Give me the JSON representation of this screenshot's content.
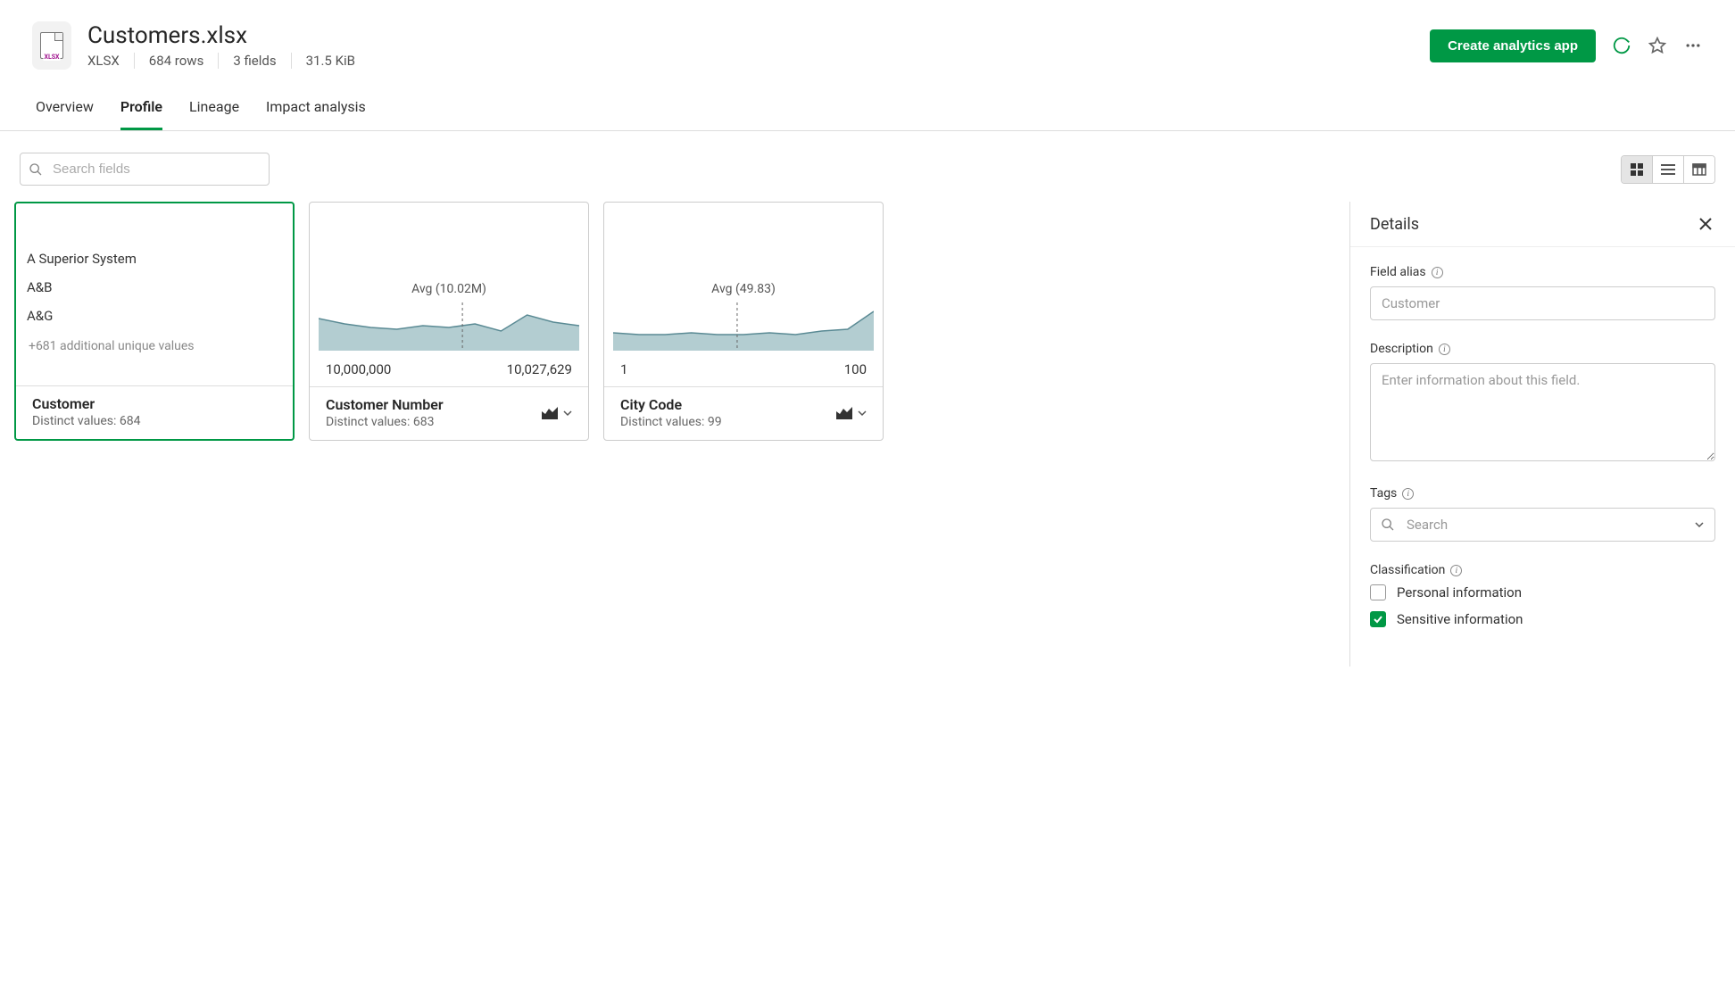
{
  "header": {
    "title": "Customers.xlsx",
    "fileType": "XLSX",
    "rows": "684 rows",
    "fields": "3 fields",
    "size": "31.5 KiB",
    "createBtn": "Create analytics app",
    "fileBadge": "XLSX"
  },
  "tabs": [
    {
      "label": "Overview",
      "active": false
    },
    {
      "label": "Profile",
      "active": true
    },
    {
      "label": "Lineage",
      "active": false
    },
    {
      "label": "Impact analysis",
      "active": false
    }
  ],
  "search": {
    "placeholder": "Search fields"
  },
  "cards": [
    {
      "type": "text",
      "fieldName": "Customer",
      "distinct": "Distinct values: 684",
      "selected": true,
      "sampleValues": [
        "A Superior System",
        "A&B",
        "A&G"
      ],
      "more": "+681 additional unique values"
    },
    {
      "type": "numeric",
      "fieldName": "Customer Number",
      "distinct": "Distinct values: 683",
      "avgLabel": "Avg (10.02M)",
      "rangeMin": "10,000,000",
      "rangeMax": "10,027,629"
    },
    {
      "type": "numeric",
      "fieldName": "City Code",
      "distinct": "Distinct values: 99",
      "avgLabel": "Avg (49.83)",
      "rangeMin": "1",
      "rangeMax": "100"
    }
  ],
  "chart_data": [
    {
      "type": "area",
      "title": "Customer Number distribution",
      "xlabel": "",
      "ylabel": "",
      "xlim": [
        10000000,
        10027629
      ],
      "avg": 10020000,
      "avg_label": "Avg (10.02M)",
      "series": [
        {
          "name": "density",
          "values": [
            36,
            30,
            26,
            24,
            28,
            26,
            30,
            22,
            40,
            32,
            28
          ]
        }
      ]
    },
    {
      "type": "area",
      "title": "City Code distribution",
      "xlabel": "",
      "ylabel": "",
      "xlim": [
        1,
        100
      ],
      "avg": 49.83,
      "avg_label": "Avg (49.83)",
      "series": [
        {
          "name": "density",
          "values": [
            12,
            10,
            10,
            12,
            10,
            10,
            12,
            10,
            14,
            16,
            32
          ]
        }
      ]
    }
  ],
  "details": {
    "title": "Details",
    "fieldAlias": {
      "label": "Field alias",
      "placeholder": "Customer"
    },
    "description": {
      "label": "Description",
      "placeholder": "Enter information about this field."
    },
    "tags": {
      "label": "Tags",
      "placeholder": "Search"
    },
    "classification": {
      "label": "Classification",
      "options": [
        {
          "label": "Personal information",
          "checked": false
        },
        {
          "label": "Sensitive information",
          "checked": true
        }
      ]
    }
  }
}
